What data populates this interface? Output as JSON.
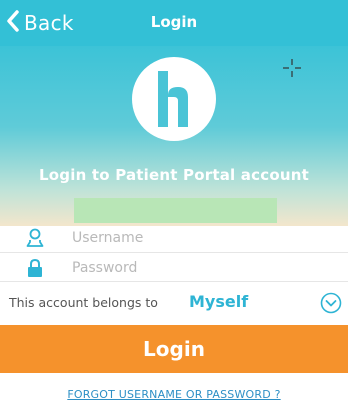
{
  "navbar": {
    "back_label": "Back",
    "title": "Login",
    "back_icon": "chevron-left-icon"
  },
  "hero": {
    "logo_icon": "h-logo-icon",
    "title": "Login to Patient Portal account"
  },
  "form": {
    "username": {
      "placeholder": "Username",
      "value": "",
      "icon": "user-icon"
    },
    "password": {
      "placeholder": "Password",
      "value": "",
      "icon": "lock-icon"
    },
    "belongs": {
      "label": "This account belongs to",
      "value": "Myself",
      "icon": "chevron-down-circle-icon"
    }
  },
  "actions": {
    "login_label": "Login",
    "forgot_label": "FORGOT USERNAME OR PASSWORD ?"
  },
  "colors": {
    "navbar": "#33c0d6",
    "accent": "#2eb4d4",
    "login_button": "#f5922c",
    "link": "#2d8fc5"
  }
}
